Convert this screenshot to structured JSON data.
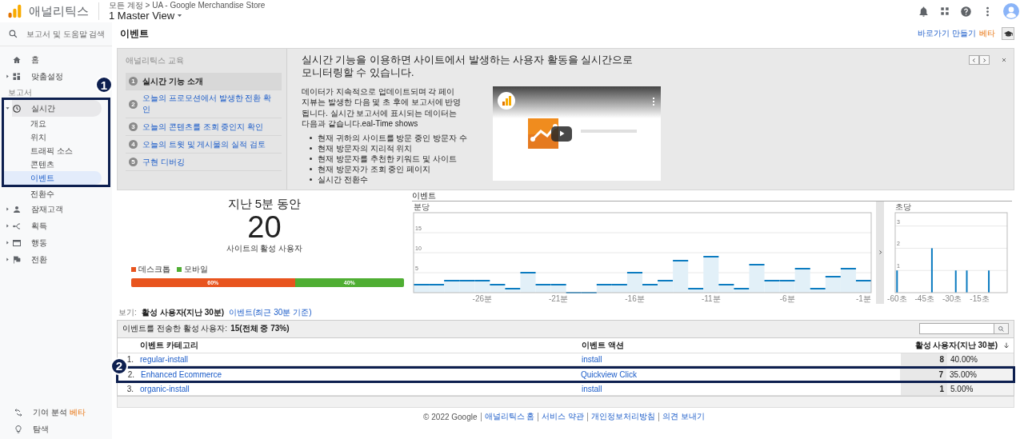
{
  "header": {
    "app_name": "애널리틱스",
    "breadcrumb": "모든 계정 > UA - Google Merchandise Store",
    "view": "1 Master View"
  },
  "sidebar": {
    "search_placeholder": "보고서 및 도움말 검색",
    "nav": [
      {
        "label": "홈",
        "expandable": false
      },
      {
        "label": "맞춤설정",
        "expandable": true
      }
    ],
    "section": "보고서",
    "reports": [
      {
        "label": "실시간",
        "expanded": true,
        "callout": "1",
        "children": [
          {
            "label": "개요",
            "selected": false
          },
          {
            "label": "위치",
            "selected": false
          },
          {
            "label": "트래픽 소스",
            "selected": false
          },
          {
            "label": "콘텐츠",
            "selected": false
          },
          {
            "label": "이벤트",
            "selected": true
          },
          {
            "label": "전환수",
            "selected": false
          }
        ]
      },
      {
        "label": "잠재고객",
        "expanded": false
      },
      {
        "label": "획득",
        "expanded": false
      },
      {
        "label": "행동",
        "expanded": false
      },
      {
        "label": "전환",
        "expanded": false
      }
    ],
    "tools": [
      {
        "label": "기여 분석",
        "badge": "베타"
      },
      {
        "label": "탐색"
      }
    ]
  },
  "page_title": "이벤트",
  "shortcut": {
    "label": "바로가기 만들기",
    "badge": "베타"
  },
  "tutorial": {
    "title": "애널리틱스 교육",
    "steps": [
      {
        "number": "1",
        "label": "실시간 기능 소개",
        "selected": true
      },
      {
        "number": "2",
        "label": "오늘의 프로모션에서 발생한 전환 확인",
        "selected": false
      },
      {
        "number": "3",
        "label": "오늘의 콘텐츠를 조회 중인지 확인",
        "selected": false
      },
      {
        "number": "4",
        "label": "오늘의 트윗 및 게시물의 실적 검토",
        "selected": false
      },
      {
        "number": "5",
        "label": "구현 디버깅",
        "selected": false
      }
    ],
    "heading": "실시간 기능을 이용하면 사이트에서 발생하는 사용자 활동을 실시간으로 모니터링할 수 있습니다.",
    "paragraph": "데이터가 지속적으로 업데이트되며 각 페이지뷰는 발생한 다음 몇 초 후에 보고서에 반영됩니다. 실시간 보고서에 표시되는 데이터는 다음과 같습니다.eal-Time shows",
    "bullets": [
      "현재 귀하의 사이트를 방문 중인 방문자 수",
      "현재 방문자의 지리적 위치",
      "현재 방문자를 추천한 키워드 및 사이트",
      "현재 방문자가 조회 중인 페이지",
      "실시간 전환수"
    ]
  },
  "summary": {
    "title": "지난 5분 동안",
    "value": "20",
    "caption": "사이트의 활성 사용자",
    "devices": [
      {
        "label": "데스크톱",
        "color": "#e8541e",
        "level": 0.6,
        "reading": "60%"
      },
      {
        "label": "모바일",
        "color": "#4fae33",
        "level": 0.4,
        "reading": "40%"
      }
    ]
  },
  "events": {
    "title": "이벤트",
    "per_minute": {
      "chart_data": {
        "type": "bar",
        "title": "분당",
        "x": [
          -30,
          -29,
          -28,
          -27,
          -26,
          -25,
          -24,
          -23,
          -22,
          -21,
          -20,
          -19,
          -18,
          -17,
          -16,
          -15,
          -14,
          -13,
          -12,
          -11,
          -10,
          -9,
          -8,
          -7,
          -6,
          -5,
          -4,
          -3,
          -2,
          -1
        ],
        "values": [
          2,
          2,
          3,
          3,
          3,
          2,
          1,
          5,
          2,
          2,
          0,
          0,
          2,
          2,
          5,
          2,
          3,
          8,
          1,
          9,
          2,
          1,
          7,
          3,
          3,
          6,
          1,
          4,
          6,
          3
        ],
        "xlim": [
          -30.5,
          -0.5
        ],
        "ylim": [
          0,
          20
        ],
        "yticks": [
          5,
          10,
          15
        ],
        "grid": true,
        "xticks": [
          {
            "value": -26,
            "label": "-26분"
          },
          {
            "value": -21,
            "label": "-21분"
          },
          {
            "value": -16,
            "label": "-16분"
          },
          {
            "value": -11,
            "label": "-11분"
          },
          {
            "value": -6,
            "label": "-6분"
          },
          {
            "value": -1,
            "label": "-1분"
          }
        ]
      }
    },
    "per_second": {
      "chart_data": {
        "type": "bar",
        "title": "초당",
        "x": [
          -60,
          -41,
          -28,
          -22,
          -10
        ],
        "values": [
          1,
          2,
          1,
          1,
          1
        ],
        "xlim": [
          -61,
          0
        ],
        "ylim": [
          0,
          3.6
        ],
        "yticks": [
          1,
          2,
          3
        ],
        "grid": true,
        "xticks": [
          {
            "value": -60,
            "label": "-60초"
          },
          {
            "value": -45,
            "label": "-45초"
          },
          {
            "value": -30,
            "label": "-30초"
          },
          {
            "value": -15,
            "label": "-15초"
          }
        ]
      }
    }
  },
  "view_toggle": {
    "label": "보기:",
    "options": [
      {
        "label": "활성 사용자(지난 30분)",
        "selected": true
      },
      {
        "label": "이벤트(최근 30분 기준)",
        "selected": false
      }
    ]
  },
  "table": {
    "summary_label": "이벤트를 전송한 활성 사용자:",
    "summary_value": "15(전체 중 73%)",
    "columns": [
      "이벤트 카테고리",
      "이벤트 액션",
      "활성 사용자(지난 30분)"
    ],
    "rows": [
      {
        "index": "1.",
        "category": "regular-install",
        "action": "install",
        "users": "8",
        "share": "40.00%"
      },
      {
        "index": "2.",
        "category": "Enhanced Ecommerce",
        "action": "Quickview Click",
        "users": "7",
        "share": "35.00%",
        "callout": "2"
      },
      {
        "index": "3.",
        "category": "organic-install",
        "action": "install",
        "users": "1",
        "share": "5.00%"
      }
    ]
  },
  "footer": {
    "copyright": "© 2022 Google",
    "links": [
      "애널리틱스 홈",
      "서비스 약관",
      "개인정보처리방침",
      "의견 보내기"
    ]
  }
}
